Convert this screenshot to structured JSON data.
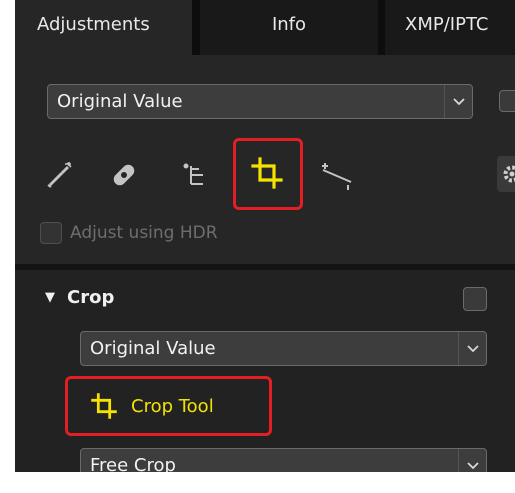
{
  "tabs": {
    "adjustments": "Adjustments",
    "info": "Info",
    "xmp": "XMP/IPTC"
  },
  "top_dropdown": {
    "value": "Original Value"
  },
  "toolbar": {
    "icons": [
      "picker-brush-icon",
      "retouch-bandage-icon",
      "levels-tree-icon",
      "crop-icon",
      "straighten-icon",
      "gear-icon"
    ],
    "active": "crop-icon"
  },
  "hdr_checkbox": {
    "label": "Adjust using HDR",
    "checked": false,
    "enabled": false
  },
  "crop_section": {
    "title": "Crop",
    "expanded": true,
    "checked": false,
    "value_dropdown": "Original Value",
    "crop_tool_label": "Crop Tool",
    "aspect_dropdown": "Free Crop"
  },
  "colors": {
    "highlight": "#e31e24",
    "crop_yellow": "#f4e200"
  }
}
